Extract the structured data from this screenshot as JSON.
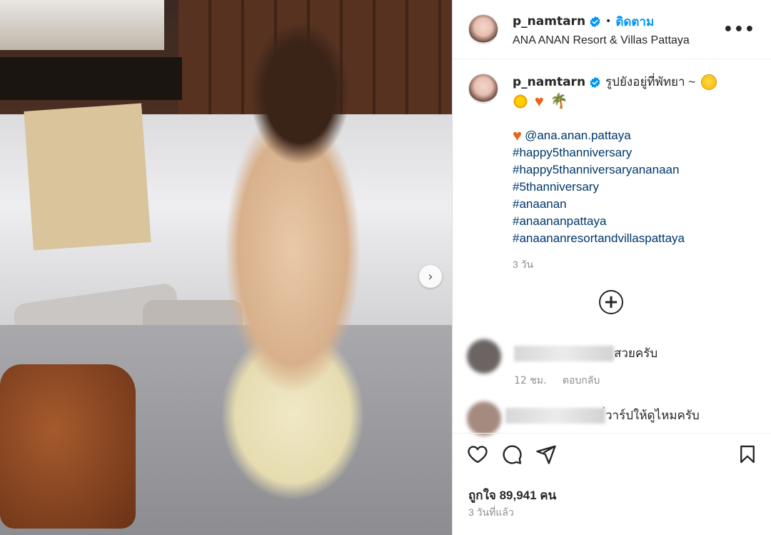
{
  "post": {
    "username": "p_namtarn",
    "follow_label": "ติดตาม",
    "location": "ANA ANAN Resort & Villas Pattaya"
  },
  "caption": {
    "username": "p_namtarn",
    "text": "รูปยังอยู่ที่พัทยา ~",
    "mention": "@ana.anan.pattaya",
    "hashtags": [
      "#happy5thanniversary",
      "#happy5thanniversaryananaan",
      "#5thanniversary",
      "#anaanan",
      "#anaananpattaya",
      "#anaananresortandvillaspattaya"
    ],
    "time": "3 วัน"
  },
  "comments": [
    {
      "text": "สวยครับ",
      "time": "12 ชม.",
      "reply_label": "ตอบกลับ"
    },
    {
      "text": "่วาร์ปให้ดูไหมครับ"
    }
  ],
  "footer": {
    "likes": "ถูกใจ 89,941 คน",
    "posted": "3 วันที่แล้ว"
  },
  "icons": {
    "verified": "verified-badge-icon",
    "more": "more-options-icon",
    "next": "chevron-right-icon",
    "add": "plus-circle-icon",
    "like": "heart-icon",
    "comment": "comment-icon",
    "share": "share-icon",
    "save": "bookmark-icon"
  },
  "colors": {
    "link": "#00376b",
    "follow": "#0095f6",
    "verified": "#0095f6",
    "muted": "#8e8e8e"
  }
}
